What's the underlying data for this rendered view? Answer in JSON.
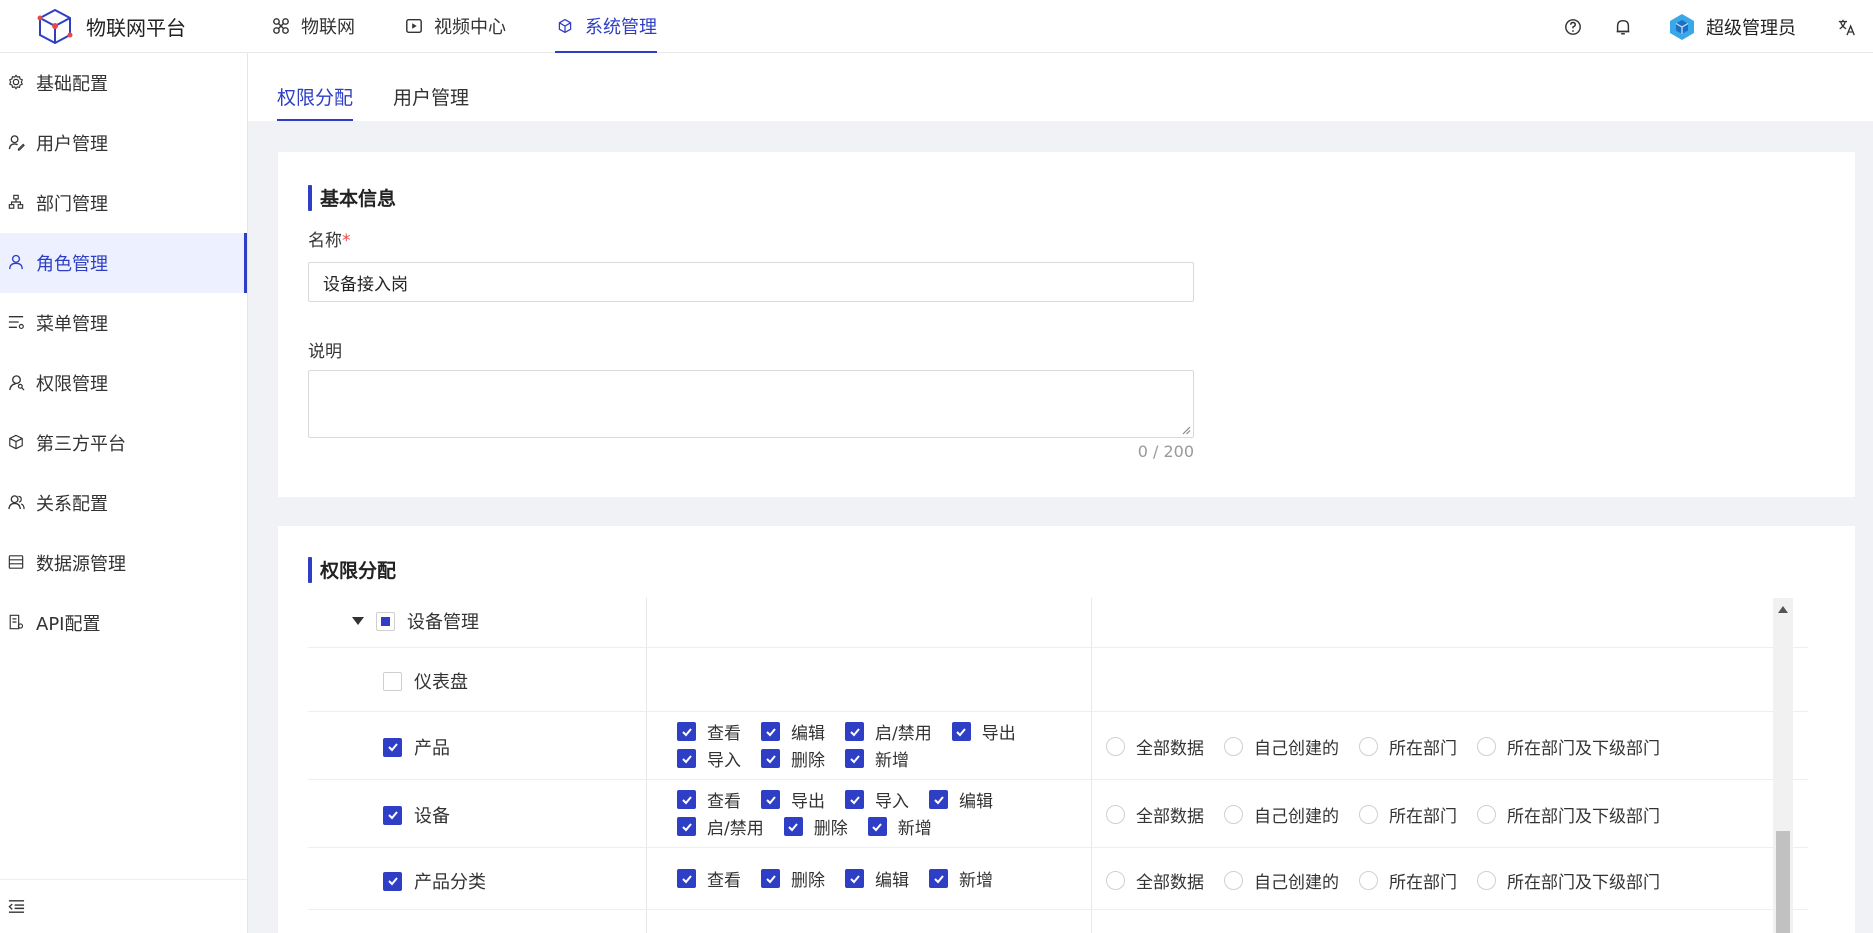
{
  "header": {
    "app_title": "物联网平台",
    "nav": [
      {
        "label": "物联网"
      },
      {
        "label": "视频中心"
      },
      {
        "label": "系统管理"
      }
    ],
    "user_name": "超级管理员"
  },
  "sidebar": {
    "items": [
      {
        "label": "基础配置"
      },
      {
        "label": "用户管理"
      },
      {
        "label": "部门管理"
      },
      {
        "label": "角色管理"
      },
      {
        "label": "菜单管理"
      },
      {
        "label": "权限管理"
      },
      {
        "label": "第三方平台"
      },
      {
        "label": "关系配置"
      },
      {
        "label": "数据源管理"
      },
      {
        "label": "API配置"
      }
    ]
  },
  "tabs": [
    {
      "label": "权限分配"
    },
    {
      "label": "用户管理"
    }
  ],
  "basic": {
    "title": "基本信息",
    "name_label": "名称",
    "required_mark": "*",
    "name_value": "设备接入岗",
    "desc_label": "说明",
    "counter": "0 / 200"
  },
  "perm": {
    "title": "权限分配",
    "group": "设备管理",
    "rows": [
      {
        "name": "仪表盘",
        "actions": []
      },
      {
        "name": "产品",
        "actions": [
          {
            "label": "查看"
          },
          {
            "label": "编辑"
          },
          {
            "label": "启/禁用"
          },
          {
            "label": "导出"
          },
          {
            "label": "导入"
          },
          {
            "label": "删除"
          },
          {
            "label": "新增"
          }
        ]
      },
      {
        "name": "设备",
        "actions": [
          {
            "label": "查看"
          },
          {
            "label": "导出"
          },
          {
            "label": "导入"
          },
          {
            "label": "编辑"
          },
          {
            "label": "启/禁用"
          },
          {
            "label": "删除"
          },
          {
            "label": "新增"
          }
        ]
      },
      {
        "name": "产品分类",
        "actions": [
          {
            "label": "查看"
          },
          {
            "label": "删除"
          },
          {
            "label": "编辑"
          },
          {
            "label": "新增"
          }
        ]
      }
    ],
    "scopes": [
      "全部数据",
      "自己创建的",
      "所在部门",
      "所在部门及下级部门"
    ]
  },
  "colors": {
    "accent": "#2f3fc5",
    "required": "#e54a4a"
  }
}
